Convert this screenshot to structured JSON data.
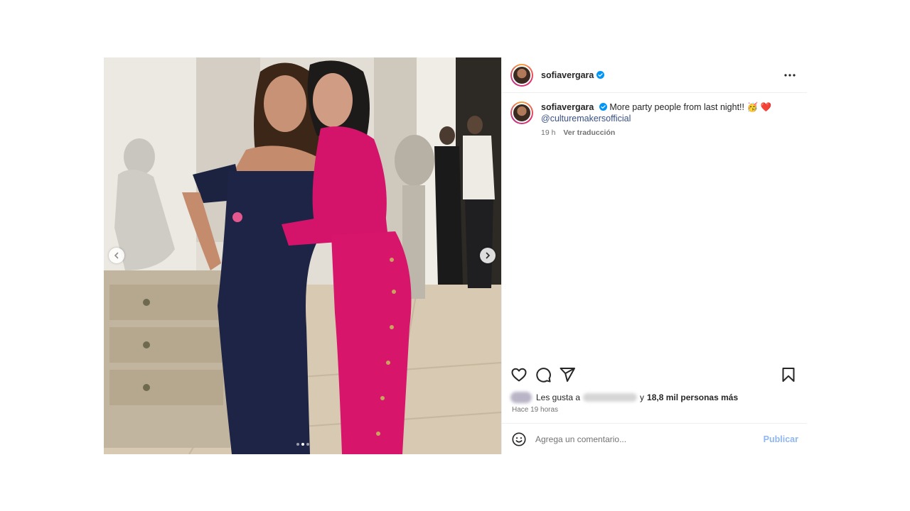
{
  "post": {
    "username": "sofiavergara",
    "caption_text": "More party people from last night!! 🥳 ❤️",
    "caption_mention": "@culturemakersofficial",
    "time_ago": "19 h",
    "translate_label": "Ver traducción",
    "likes_prefix": "Les gusta a",
    "likes_connector": "y",
    "likes_count": "18,8 mil personas más",
    "timestamp": "Hace 19 horas",
    "comment_placeholder": "Agrega un comentario...",
    "publish_label": "Publicar"
  },
  "carousel": {
    "total": 3,
    "active_index": 1
  },
  "icons": {
    "verified": "verified-badge-icon",
    "more": "more-options-icon",
    "like": "heart-icon",
    "comment": "comment-icon",
    "share": "share-icon",
    "save": "bookmark-icon",
    "emoji": "emoji-icon",
    "prev": "chevron-left-icon",
    "next": "chevron-right-icon"
  },
  "colors": {
    "verified": "#0095f6",
    "link": "#385185",
    "publish": "#8fb7f0"
  }
}
